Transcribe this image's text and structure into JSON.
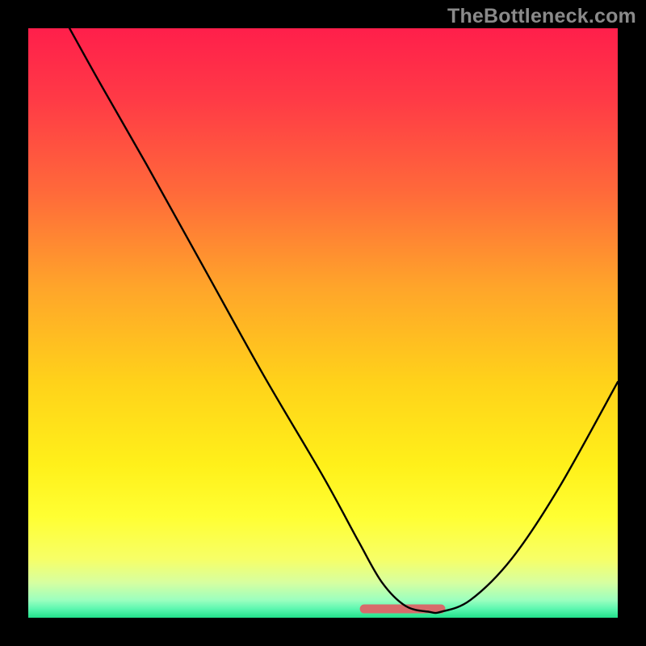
{
  "watermark": "TheBottleneck.com",
  "gradient_stops": [
    {
      "offset": 0.0,
      "color": "#ff1f4b"
    },
    {
      "offset": 0.12,
      "color": "#ff3a46"
    },
    {
      "offset": 0.28,
      "color": "#ff6a3a"
    },
    {
      "offset": 0.44,
      "color": "#ffa52a"
    },
    {
      "offset": 0.6,
      "color": "#ffd21a"
    },
    {
      "offset": 0.74,
      "color": "#fff01a"
    },
    {
      "offset": 0.83,
      "color": "#ffff33"
    },
    {
      "offset": 0.9,
      "color": "#f7ff66"
    },
    {
      "offset": 0.94,
      "color": "#d7ffa0"
    },
    {
      "offset": 0.97,
      "color": "#9cffbf"
    },
    {
      "offset": 0.985,
      "color": "#5cf7b0"
    },
    {
      "offset": 1.0,
      "color": "#22e08a"
    }
  ],
  "chart_data": {
    "type": "line",
    "title": "",
    "xlabel": "",
    "ylabel": "",
    "xlim": [
      0,
      100
    ],
    "ylim": [
      0,
      100
    ],
    "series": [
      {
        "name": "bottleneck-curve",
        "x": [
          7,
          12,
          20,
          30,
          40,
          50,
          56,
          60,
          64,
          68,
          70,
          75,
          82,
          90,
          100
        ],
        "y": [
          100,
          91,
          77,
          59,
          41,
          24,
          13,
          6,
          2,
          1,
          1,
          3,
          10,
          22,
          40
        ],
        "stroke": "#000000",
        "stroke_width": 2.4
      },
      {
        "name": "flat-highlight",
        "x": [
          57,
          70
        ],
        "y": [
          1.5,
          1.5
        ],
        "stroke": "#d76b6b",
        "stroke_width": 11
      }
    ]
  }
}
